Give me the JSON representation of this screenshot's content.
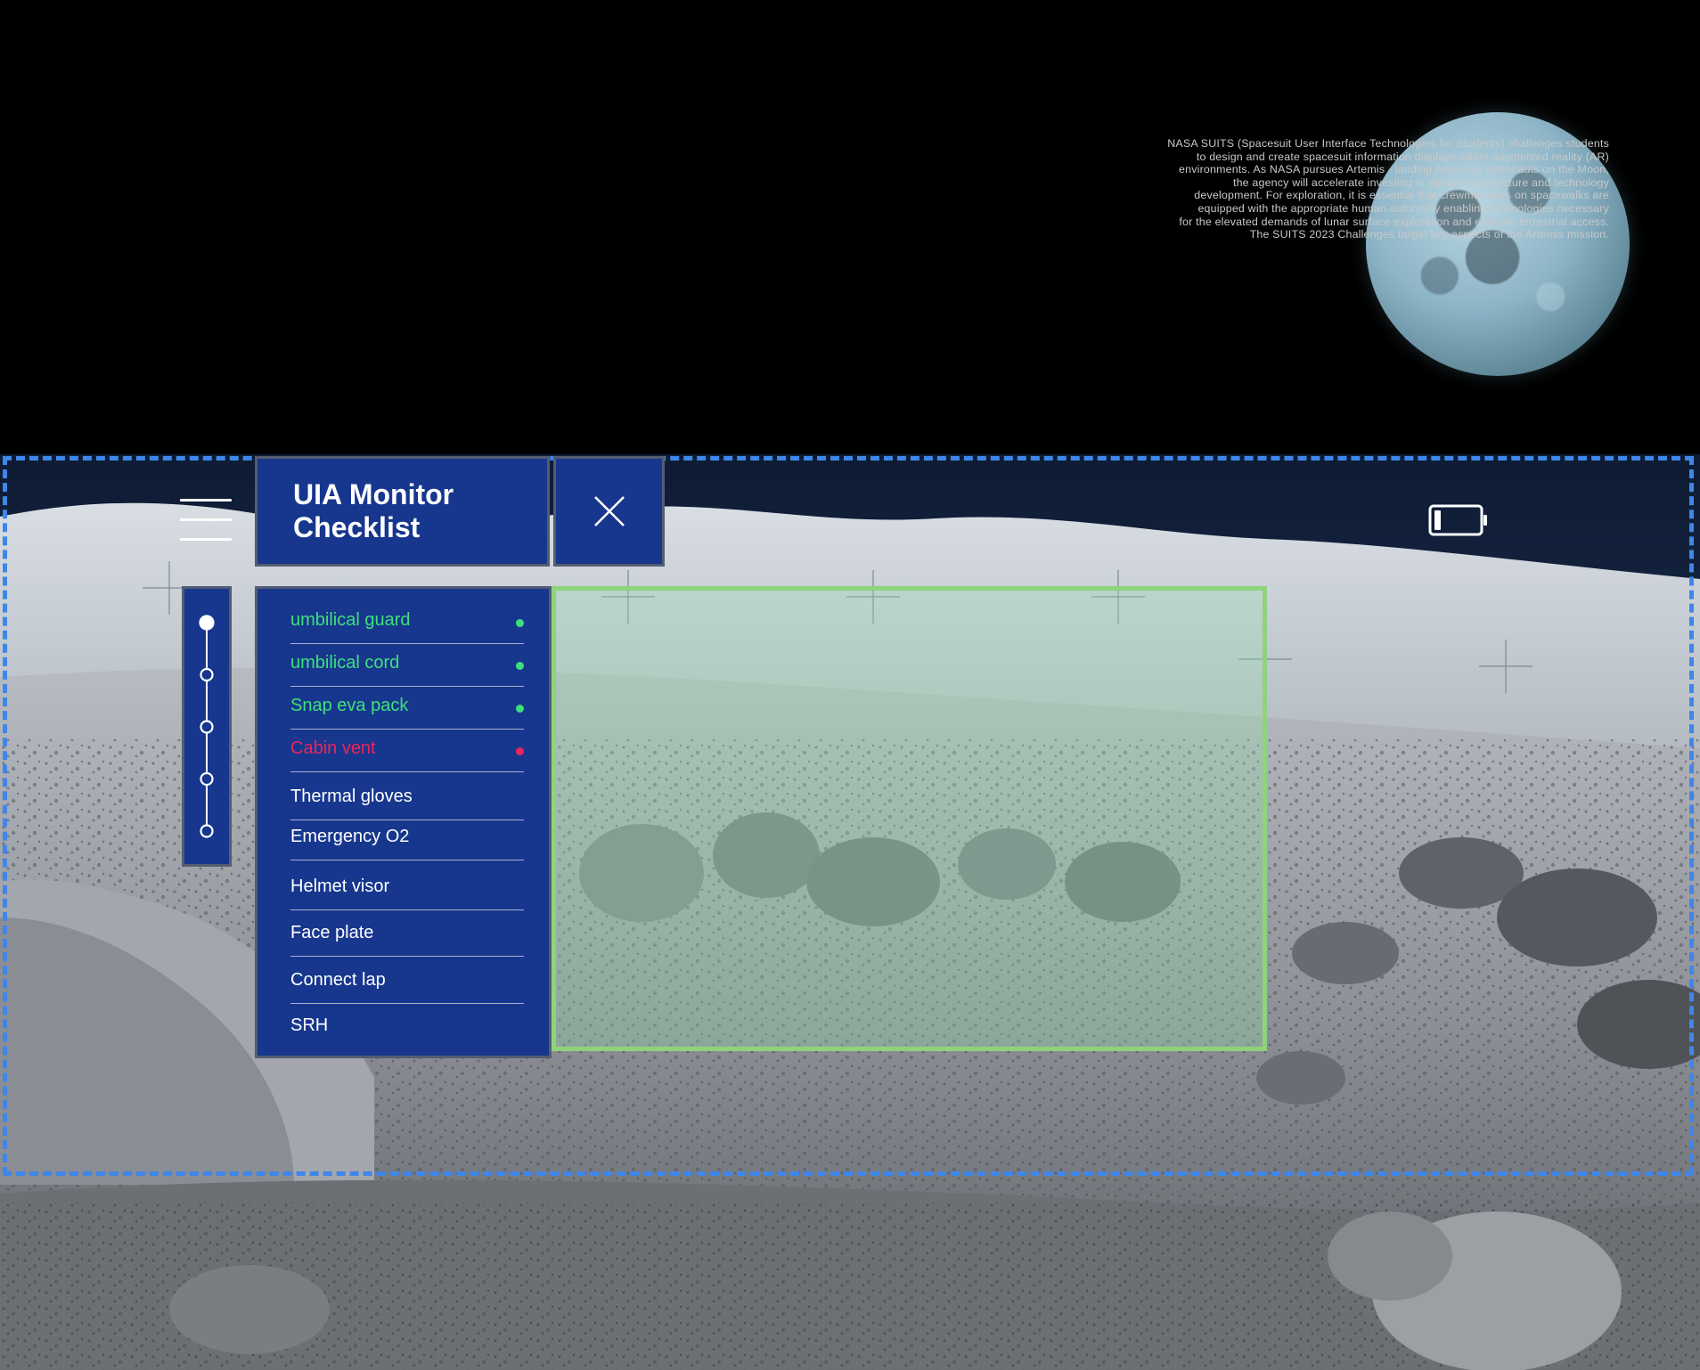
{
  "intro": {
    "lines": [
      "NASA SUITS (Spacesuit User Interface Technologies for Students) challenges students",
      "to design and create spacesuit information displays within augmented reality (AR)",
      "environments. As NASA pursues Artemis - landing American astronauts on the Moon,",
      "the agency will accelerate investing in surface architecture and technology",
      "development. For exploration, it is essential that crewmembers on spacewalks are",
      "equipped with the appropriate human-autonomy enabling technologies necessary",
      "for the elevated demands of lunar surface exploration and extreme terrestrial access.",
      "The SUITS 2023 Challenges target key aspects of the Artemis mission."
    ]
  },
  "hud": {
    "title_line1": "UIA Monitor",
    "title_line2": "Checklist",
    "menu_icon": "hamburger-menu-icon",
    "close_icon": "close-x-icon",
    "battery_icon": "battery-low-icon",
    "battery_level": 0.15,
    "stepper_steps": 5,
    "stepper_current": 1
  },
  "checklist": {
    "items": [
      {
        "label": "umbilical guard",
        "status": "done"
      },
      {
        "label": "umbilical cord",
        "status": "done"
      },
      {
        "label": "Snap eva pack",
        "status": "done"
      },
      {
        "label": "Cabin vent",
        "status": "alert"
      },
      {
        "label": "Thermal gloves",
        "status": "pending"
      },
      {
        "label": "Emergency O2",
        "status": "pending"
      },
      {
        "label": "Helmet visor",
        "status": "pending"
      },
      {
        "label": "Face plate",
        "status": "pending"
      },
      {
        "label": "Connect lap",
        "status": "pending"
      },
      {
        "label": "SRH",
        "status": "pending"
      }
    ]
  },
  "colors": {
    "panel": "#17378e",
    "panel_border": "#545d70",
    "done": "#3ee07a",
    "alert": "#f0245a",
    "pending": "#ffffff",
    "frame_dash": "#3f86e8",
    "focus_border": "#8fd37b"
  }
}
